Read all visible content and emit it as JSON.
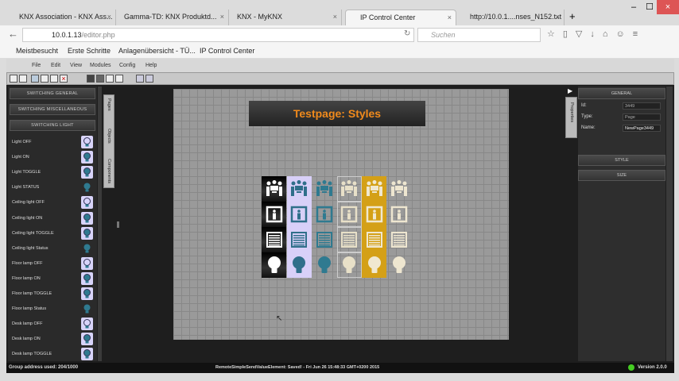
{
  "browser": {
    "tabs": [
      {
        "label": "KNX Association - KNX Ass..."
      },
      {
        "label": "Gamma-TD: KNX Produktd..."
      },
      {
        "label": "KNX - MyKNX"
      },
      {
        "label": "IP Control Center",
        "active": true
      },
      {
        "label": "http://10.0.1....nses_N152.txt"
      }
    ],
    "url_host": "10.0.1.13",
    "url_path": "/editor.php",
    "search_placeholder": "Suchen",
    "bookmarks": [
      "Meistbesucht",
      "Erste Schritte",
      "Anlagenübersicht - TÜ...",
      "IP Control Center"
    ]
  },
  "app": {
    "menu": [
      "File",
      "Edit",
      "View",
      "Modules",
      "Config",
      "Help"
    ],
    "left_panel": {
      "sections": [
        "SWITCHING GENERAL",
        "SWITCHING MISCELLANEOUS",
        "SWITCHING LIGHT"
      ],
      "items": [
        {
          "label": "Light OFF",
          "icon": "bulb-off"
        },
        {
          "label": "Light ON",
          "icon": "bulb-on"
        },
        {
          "label": "Light TOGGLE",
          "icon": "bulb-toggle"
        },
        {
          "label": "Light STATUS",
          "icon": "bulb-status"
        },
        {
          "label": "Ceiling light OFF",
          "icon": "ceiling-off"
        },
        {
          "label": "Ceiling light ON",
          "icon": "ceiling-on"
        },
        {
          "label": "Ceiling light TOGGLE",
          "icon": "ceiling-toggle"
        },
        {
          "label": "Ceiling light Status",
          "icon": "ceiling-status"
        },
        {
          "label": "Floor lamp OFF",
          "icon": "floor-off"
        },
        {
          "label": "Floor lamp ON",
          "icon": "floor-on"
        },
        {
          "label": "Floor lamp TOGGLE",
          "icon": "floor-toggle"
        },
        {
          "label": "Floor lamp Status",
          "icon": "floor-status"
        },
        {
          "label": "Desk lamp OFF",
          "icon": "desk-off"
        },
        {
          "label": "Desk lamp ON",
          "icon": "desk-on"
        },
        {
          "label": "Desk lamp TOGGLE",
          "icon": "desk-toggle"
        }
      ]
    },
    "side_tabs": [
      "Pages",
      "Objects",
      "Components"
    ],
    "page_title": "Testpage: Styles",
    "grid_rows": [
      "people",
      "door",
      "blind",
      "bulb"
    ],
    "grid_styles": [
      {
        "bg": "#111111",
        "fg": "#ffffff"
      },
      {
        "bg": "#d8d0f8",
        "fg": "#2f6f8a"
      },
      {
        "bg": "transparent",
        "fg": "#2f7a90"
      },
      {
        "bg": "transparent",
        "fg": "#e8e0c8",
        "border": true
      },
      {
        "bg": "#d4a017",
        "fg": "#f0e8d0"
      },
      {
        "bg": "transparent",
        "fg": "#eee6d0"
      }
    ],
    "properties": {
      "tab": "Properties",
      "section": "GENERAL",
      "fields": [
        {
          "label": "Id:",
          "value": "3449"
        },
        {
          "label": "Type:",
          "value": "Page"
        },
        {
          "label": "Name:",
          "value": "NewPage3449"
        }
      ],
      "sections": [
        "STYLE",
        "SIZE"
      ]
    },
    "status": {
      "left": "Group address used: 204/1000",
      "center": "RemoteSimpleSendValueElement: Saved! - Fri Jun 26 15:48:33 GMT+0200 2015",
      "version": "Version 2.0.0",
      "indicator_color": "#44cc22"
    }
  }
}
